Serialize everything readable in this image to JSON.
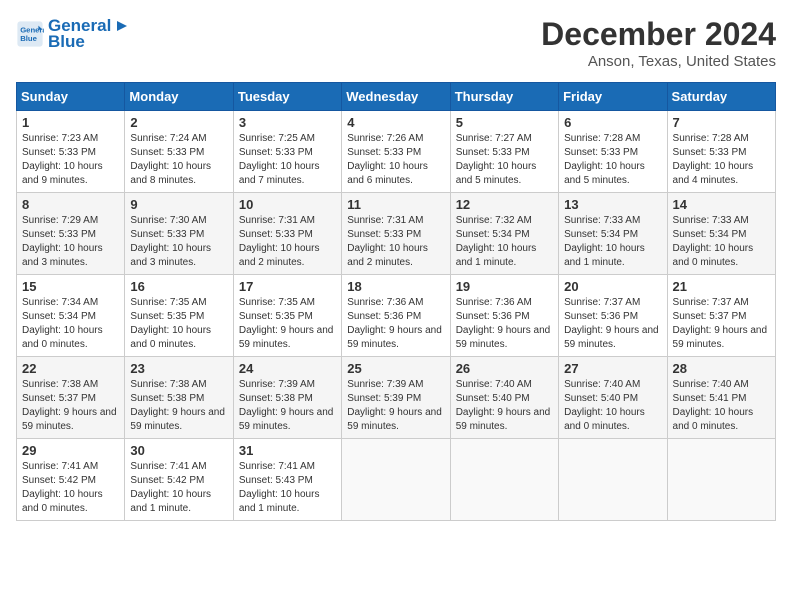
{
  "header": {
    "logo_line1": "General",
    "logo_line2": "Blue",
    "month_year": "December 2024",
    "location": "Anson, Texas, United States"
  },
  "weekdays": [
    "Sunday",
    "Monday",
    "Tuesday",
    "Wednesday",
    "Thursday",
    "Friday",
    "Saturday"
  ],
  "weeks": [
    [
      {
        "day": "1",
        "sunrise": "7:23 AM",
        "sunset": "5:33 PM",
        "daylight": "10 hours and 9 minutes."
      },
      {
        "day": "2",
        "sunrise": "7:24 AM",
        "sunset": "5:33 PM",
        "daylight": "10 hours and 8 minutes."
      },
      {
        "day": "3",
        "sunrise": "7:25 AM",
        "sunset": "5:33 PM",
        "daylight": "10 hours and 7 minutes."
      },
      {
        "day": "4",
        "sunrise": "7:26 AM",
        "sunset": "5:33 PM",
        "daylight": "10 hours and 6 minutes."
      },
      {
        "day": "5",
        "sunrise": "7:27 AM",
        "sunset": "5:33 PM",
        "daylight": "10 hours and 5 minutes."
      },
      {
        "day": "6",
        "sunrise": "7:28 AM",
        "sunset": "5:33 PM",
        "daylight": "10 hours and 5 minutes."
      },
      {
        "day": "7",
        "sunrise": "7:28 AM",
        "sunset": "5:33 PM",
        "daylight": "10 hours and 4 minutes."
      }
    ],
    [
      {
        "day": "8",
        "sunrise": "7:29 AM",
        "sunset": "5:33 PM",
        "daylight": "10 hours and 3 minutes."
      },
      {
        "day": "9",
        "sunrise": "7:30 AM",
        "sunset": "5:33 PM",
        "daylight": "10 hours and 3 minutes."
      },
      {
        "day": "10",
        "sunrise": "7:31 AM",
        "sunset": "5:33 PM",
        "daylight": "10 hours and 2 minutes."
      },
      {
        "day": "11",
        "sunrise": "7:31 AM",
        "sunset": "5:33 PM",
        "daylight": "10 hours and 2 minutes."
      },
      {
        "day": "12",
        "sunrise": "7:32 AM",
        "sunset": "5:34 PM",
        "daylight": "10 hours and 1 minute."
      },
      {
        "day": "13",
        "sunrise": "7:33 AM",
        "sunset": "5:34 PM",
        "daylight": "10 hours and 1 minute."
      },
      {
        "day": "14",
        "sunrise": "7:33 AM",
        "sunset": "5:34 PM",
        "daylight": "10 hours and 0 minutes."
      }
    ],
    [
      {
        "day": "15",
        "sunrise": "7:34 AM",
        "sunset": "5:34 PM",
        "daylight": "10 hours and 0 minutes."
      },
      {
        "day": "16",
        "sunrise": "7:35 AM",
        "sunset": "5:35 PM",
        "daylight": "10 hours and 0 minutes."
      },
      {
        "day": "17",
        "sunrise": "7:35 AM",
        "sunset": "5:35 PM",
        "daylight": "9 hours and 59 minutes."
      },
      {
        "day": "18",
        "sunrise": "7:36 AM",
        "sunset": "5:36 PM",
        "daylight": "9 hours and 59 minutes."
      },
      {
        "day": "19",
        "sunrise": "7:36 AM",
        "sunset": "5:36 PM",
        "daylight": "9 hours and 59 minutes."
      },
      {
        "day": "20",
        "sunrise": "7:37 AM",
        "sunset": "5:36 PM",
        "daylight": "9 hours and 59 minutes."
      },
      {
        "day": "21",
        "sunrise": "7:37 AM",
        "sunset": "5:37 PM",
        "daylight": "9 hours and 59 minutes."
      }
    ],
    [
      {
        "day": "22",
        "sunrise": "7:38 AM",
        "sunset": "5:37 PM",
        "daylight": "9 hours and 59 minutes."
      },
      {
        "day": "23",
        "sunrise": "7:38 AM",
        "sunset": "5:38 PM",
        "daylight": "9 hours and 59 minutes."
      },
      {
        "day": "24",
        "sunrise": "7:39 AM",
        "sunset": "5:38 PM",
        "daylight": "9 hours and 59 minutes."
      },
      {
        "day": "25",
        "sunrise": "7:39 AM",
        "sunset": "5:39 PM",
        "daylight": "9 hours and 59 minutes."
      },
      {
        "day": "26",
        "sunrise": "7:40 AM",
        "sunset": "5:40 PM",
        "daylight": "9 hours and 59 minutes."
      },
      {
        "day": "27",
        "sunrise": "7:40 AM",
        "sunset": "5:40 PM",
        "daylight": "10 hours and 0 minutes."
      },
      {
        "day": "28",
        "sunrise": "7:40 AM",
        "sunset": "5:41 PM",
        "daylight": "10 hours and 0 minutes."
      }
    ],
    [
      {
        "day": "29",
        "sunrise": "7:41 AM",
        "sunset": "5:42 PM",
        "daylight": "10 hours and 0 minutes."
      },
      {
        "day": "30",
        "sunrise": "7:41 AM",
        "sunset": "5:42 PM",
        "daylight": "10 hours and 1 minute."
      },
      {
        "day": "31",
        "sunrise": "7:41 AM",
        "sunset": "5:43 PM",
        "daylight": "10 hours and 1 minute."
      },
      null,
      null,
      null,
      null
    ]
  ],
  "labels": {
    "sunrise": "Sunrise: ",
    "sunset": "Sunset: ",
    "daylight": "Daylight: "
  }
}
